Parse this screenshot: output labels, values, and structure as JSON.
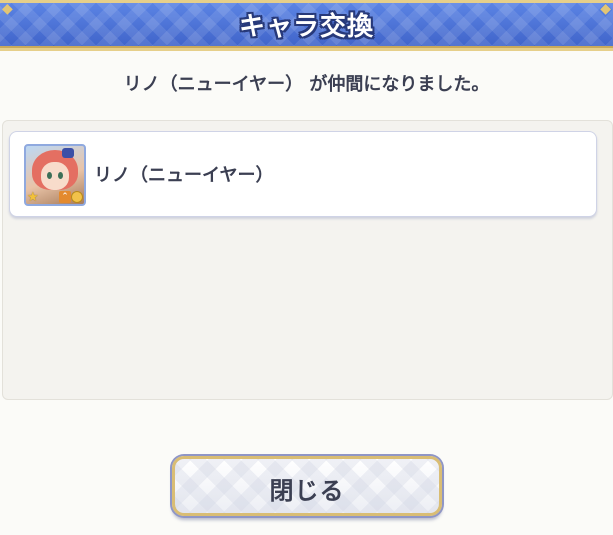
{
  "dialog": {
    "title": "キャラ交換",
    "message": "リノ（ニューイヤー） が仲間になりました。",
    "character": {
      "name": "リノ（ニューイヤー）",
      "star_icon": "star-icon",
      "rank_icon": "rank-up-icon",
      "badge_icon": "coin-icon"
    },
    "close_label": "閉じる",
    "colors": {
      "header_blue": "#4a6fd6",
      "gold_trim": "#e6cf8a",
      "text": "#3b3f52"
    }
  }
}
